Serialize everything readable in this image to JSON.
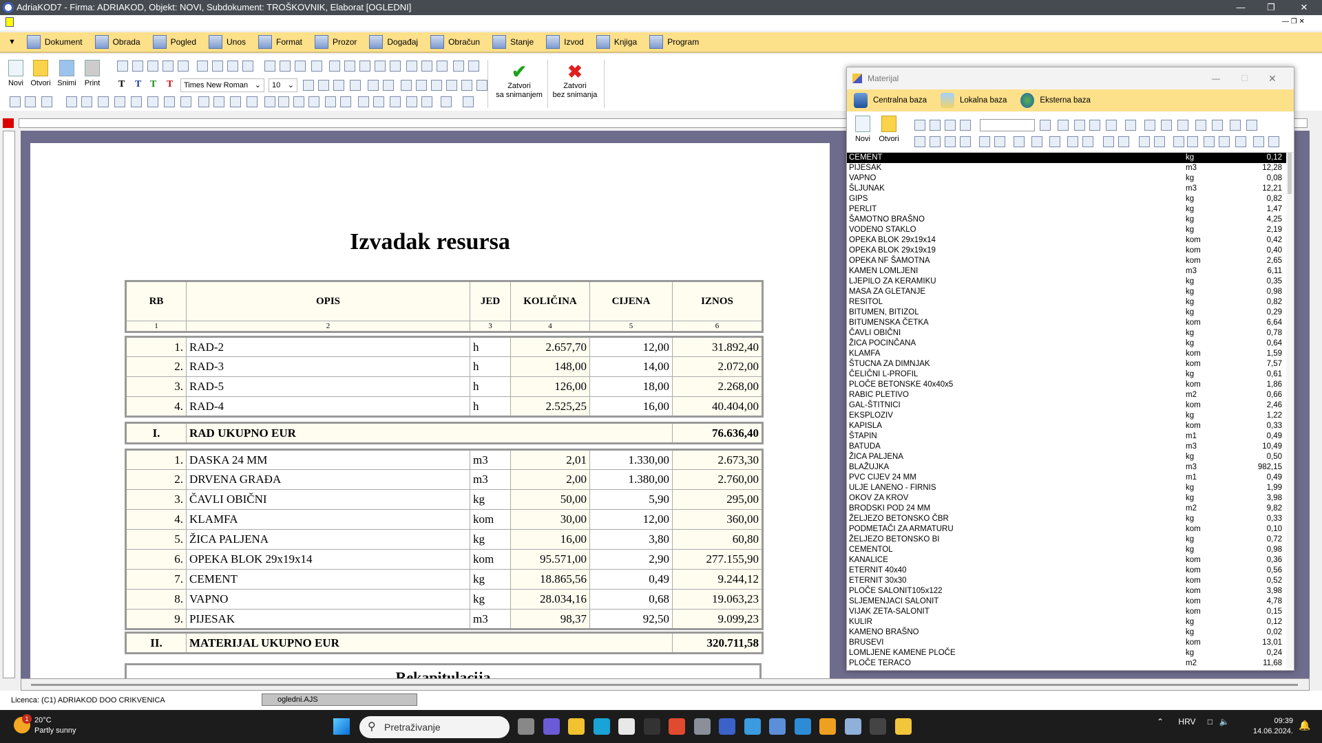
{
  "window": {
    "title": "AdriaKOD7 - Firma: ADRIAKOD,   Objekt: NOVI,   Subdokument: TROŠKOVNIK,  Elaborat [OGLEDNI]"
  },
  "menu": [
    {
      "label": "Dokument",
      "icon": "document-icon"
    },
    {
      "label": "Obrada",
      "icon": "tools-icon"
    },
    {
      "label": "Pogled",
      "icon": "magnifier-icon"
    },
    {
      "label": "Unos",
      "icon": "input-icon"
    },
    {
      "label": "Format",
      "icon": "brush-icon"
    },
    {
      "label": "Prozor",
      "icon": "window-icon"
    },
    {
      "label": "Događaj",
      "icon": "grid-icon"
    },
    {
      "label": "Obračun",
      "icon": "grid-icon"
    },
    {
      "label": "Stanje",
      "icon": "grid-icon"
    },
    {
      "label": "Izvod",
      "icon": "grid-icon"
    },
    {
      "label": "Knjiga",
      "icon": "grid-icon"
    },
    {
      "label": "Program",
      "icon": "gear-icon"
    }
  ],
  "toolbar": {
    "new": "Novi",
    "open": "Otvori",
    "save": "Snimi",
    "print": "Print",
    "font": "Times New Roman",
    "size": "10",
    "close_save": [
      "Zatvori",
      "sa snimanjem"
    ],
    "close_nosave": [
      "Zatvori",
      "bez snimanja"
    ],
    "colors": {
      "accent_yellow": "#fde08a",
      "doc_bg": "#6e6c8c",
      "ok": "#1aa31a",
      "cancel": "#e02020"
    }
  },
  "document": {
    "title": "Izvadak resursa",
    "headers": [
      "RB",
      "OPIS",
      "JED",
      "KOLIČINA",
      "CIJENA",
      "IZNOS"
    ],
    "col_numbers": [
      "1",
      "2",
      "3",
      "4",
      "5",
      "6"
    ],
    "rad_rows": [
      [
        "1.",
        "RAD-2",
        "h",
        "2.657,70",
        "12,00",
        "31.892,40"
      ],
      [
        "2.",
        "RAD-3",
        "h",
        "148,00",
        "14,00",
        "2.072,00"
      ],
      [
        "3.",
        "RAD-5",
        "h",
        "126,00",
        "18,00",
        "2.268,00"
      ],
      [
        "4.",
        "RAD-4",
        "h",
        "2.525,25",
        "16,00",
        "40.404,00"
      ]
    ],
    "rad_total": [
      "I.",
      "RAD UKUPNO EUR",
      "76.636,40"
    ],
    "mat_rows": [
      [
        "1.",
        "DASKA 24 MM",
        "m3",
        "2,01",
        "1.330,00",
        "2.673,30"
      ],
      [
        "2.",
        "DRVENA GRAĐA",
        "m3",
        "2,00",
        "1.380,00",
        "2.760,00"
      ],
      [
        "3.",
        "ČAVLI OBIČNI",
        "kg",
        "50,00",
        "5,90",
        "295,00"
      ],
      [
        "4.",
        "KLAMFA",
        "kom",
        "30,00",
        "12,00",
        "360,00"
      ],
      [
        "5.",
        "ŽICA PALJENA",
        "kg",
        "16,00",
        "3,80",
        "60,80"
      ],
      [
        "6.",
        "OPEKA BLOK 29x19x14",
        "kom",
        "95.571,00",
        "2,90",
        "277.155,90"
      ],
      [
        "7.",
        "CEMENT",
        "kg",
        "18.865,56",
        "0,49",
        "9.244,12"
      ],
      [
        "8.",
        "VAPNO",
        "kg",
        "28.034,16",
        "0,68",
        "19.063,23"
      ],
      [
        "9.",
        "PIJESAK",
        "m3",
        "98,37",
        "92,50",
        "9.099,23"
      ]
    ],
    "mat_total": [
      "II.",
      "MATERIJAL UKUPNO EUR",
      "320.711,58"
    ],
    "recap_title": "Rekapitulacija"
  },
  "materijal": {
    "title": "Materijal",
    "bases": [
      {
        "label": "Centralna baza",
        "icon": "database-icon"
      },
      {
        "label": "Lokalna baza",
        "icon": "floppy-icon"
      },
      {
        "label": "Eksterna baza",
        "icon": "globe-icon"
      }
    ],
    "new": "Novi",
    "open": "Otvori",
    "search_value": "",
    "selected_index": 0,
    "items": [
      [
        "CEMENT",
        "kg",
        "0,12"
      ],
      [
        "PIJESAK",
        "m3",
        "12,28"
      ],
      [
        "VAPNO",
        "kg",
        "0,08"
      ],
      [
        "ŠLJUNAK",
        "m3",
        "12,21"
      ],
      [
        "GIPS",
        "kg",
        "0,82"
      ],
      [
        "PERLIT",
        "kg",
        "1,47"
      ],
      [
        "ŠAMOTNO BRAŠNO",
        "kg",
        "4,25"
      ],
      [
        "VODENO STAKLO",
        "kg",
        "2,19"
      ],
      [
        "OPEKA BLOK 29x19x14",
        "kom",
        "0,42"
      ],
      [
        "OPEKA BLOK 29x19x19",
        "kom",
        "0,40"
      ],
      [
        "OPEKA NF ŠAMOTNA",
        "kom",
        "2,65"
      ],
      [
        "KAMEN LOMLJENI",
        "m3",
        "6,11"
      ],
      [
        "LJEPILO ZA KERAMIKU",
        "kg",
        "0,35"
      ],
      [
        "MASA ZA GLETANJE",
        "kg",
        "0,98"
      ],
      [
        "RESITOL",
        "kg",
        "0,82"
      ],
      [
        "BITUMEN, BITIZOL",
        "kg",
        "0,29"
      ],
      [
        "BITUMENSKA ČETKA",
        "kom",
        "6,64"
      ],
      [
        "ČAVLI OBIČNI",
        "kg",
        "0,78"
      ],
      [
        "ŽICA POCINČANA",
        "kg",
        "0,64"
      ],
      [
        "KLAMFA",
        "kom",
        "1,59"
      ],
      [
        "ŠTUCNA ZA DIMNJAK",
        "kom",
        "7,57"
      ],
      [
        "ČELIČNI L-PROFIL",
        "kg",
        "0,61"
      ],
      [
        "PLOČE BETONSKE 40x40x5",
        "kom",
        "1,86"
      ],
      [
        "RABIC PLETIVO",
        "m2",
        "0,66"
      ],
      [
        "GAL-ŠTITNICI",
        "kom",
        "2,46"
      ],
      [
        "EKSPLOZIV",
        "kg",
        "1,22"
      ],
      [
        "KAPISLA",
        "kom",
        "0,33"
      ],
      [
        "ŠTAPIN",
        "m1",
        "0,49"
      ],
      [
        "BATUDA",
        "m3",
        "10,49"
      ],
      [
        "ŽICA PALJENA",
        "kg",
        "0,50"
      ],
      [
        "BLAŽUJKA",
        "m3",
        "982,15"
      ],
      [
        "PVC CIJEV 24 MM",
        "m1",
        "0,49"
      ],
      [
        "ULJE LANENO - FIRNIS",
        "kg",
        "1,99"
      ],
      [
        "OKOV ZA KROV",
        "kg",
        "3,98"
      ],
      [
        "BRODSKI POD 24 MM",
        "m2",
        "9,82"
      ],
      [
        "ŽELJEZO BETONSKO ČBR",
        "kg",
        "0,33"
      ],
      [
        "PODMETAČI ZA ARMATURU",
        "kom",
        "0,10"
      ],
      [
        "ŽELJEZO BETONSKO BI",
        "kg",
        "0,72"
      ],
      [
        "CEMENTOL",
        "kg",
        "0,98"
      ],
      [
        "KANALICE",
        "kom",
        "0,36"
      ],
      [
        "ETERNIT 40x40",
        "kom",
        "0,56"
      ],
      [
        "ETERNIT 30x30",
        "kom",
        "0,52"
      ],
      [
        "PLOČE SALONIT105x122",
        "kom",
        "3,98"
      ],
      [
        "SLJEMENJACI SALONIT",
        "kom",
        "4,78"
      ],
      [
        "VIJAK ZETA-SALONIT",
        "kom",
        "0,15"
      ],
      [
        "KULIR",
        "kg",
        "0,12"
      ],
      [
        "KAMENO BRAŠNO",
        "kg",
        "0,02"
      ],
      [
        "BRUSEVI",
        "kom",
        "13,01"
      ],
      [
        "LOMLJENE KAMENE PLOČE",
        "kg",
        "0,24"
      ],
      [
        "PLOČE TERACO",
        "m2",
        "11,68"
      ]
    ]
  },
  "status": {
    "licence": "Licenca:  (C1) ADRIAKOD DOO CRIKVENICA",
    "file_tab": "ogledni.AJS"
  },
  "taskbar": {
    "temp": "20°C",
    "weather": "Partly sunny",
    "weather_badge": "1",
    "search_placeholder": "Pretraživanje",
    "lang": "HRV",
    "time": "09:39",
    "date": "14.06.2024."
  }
}
